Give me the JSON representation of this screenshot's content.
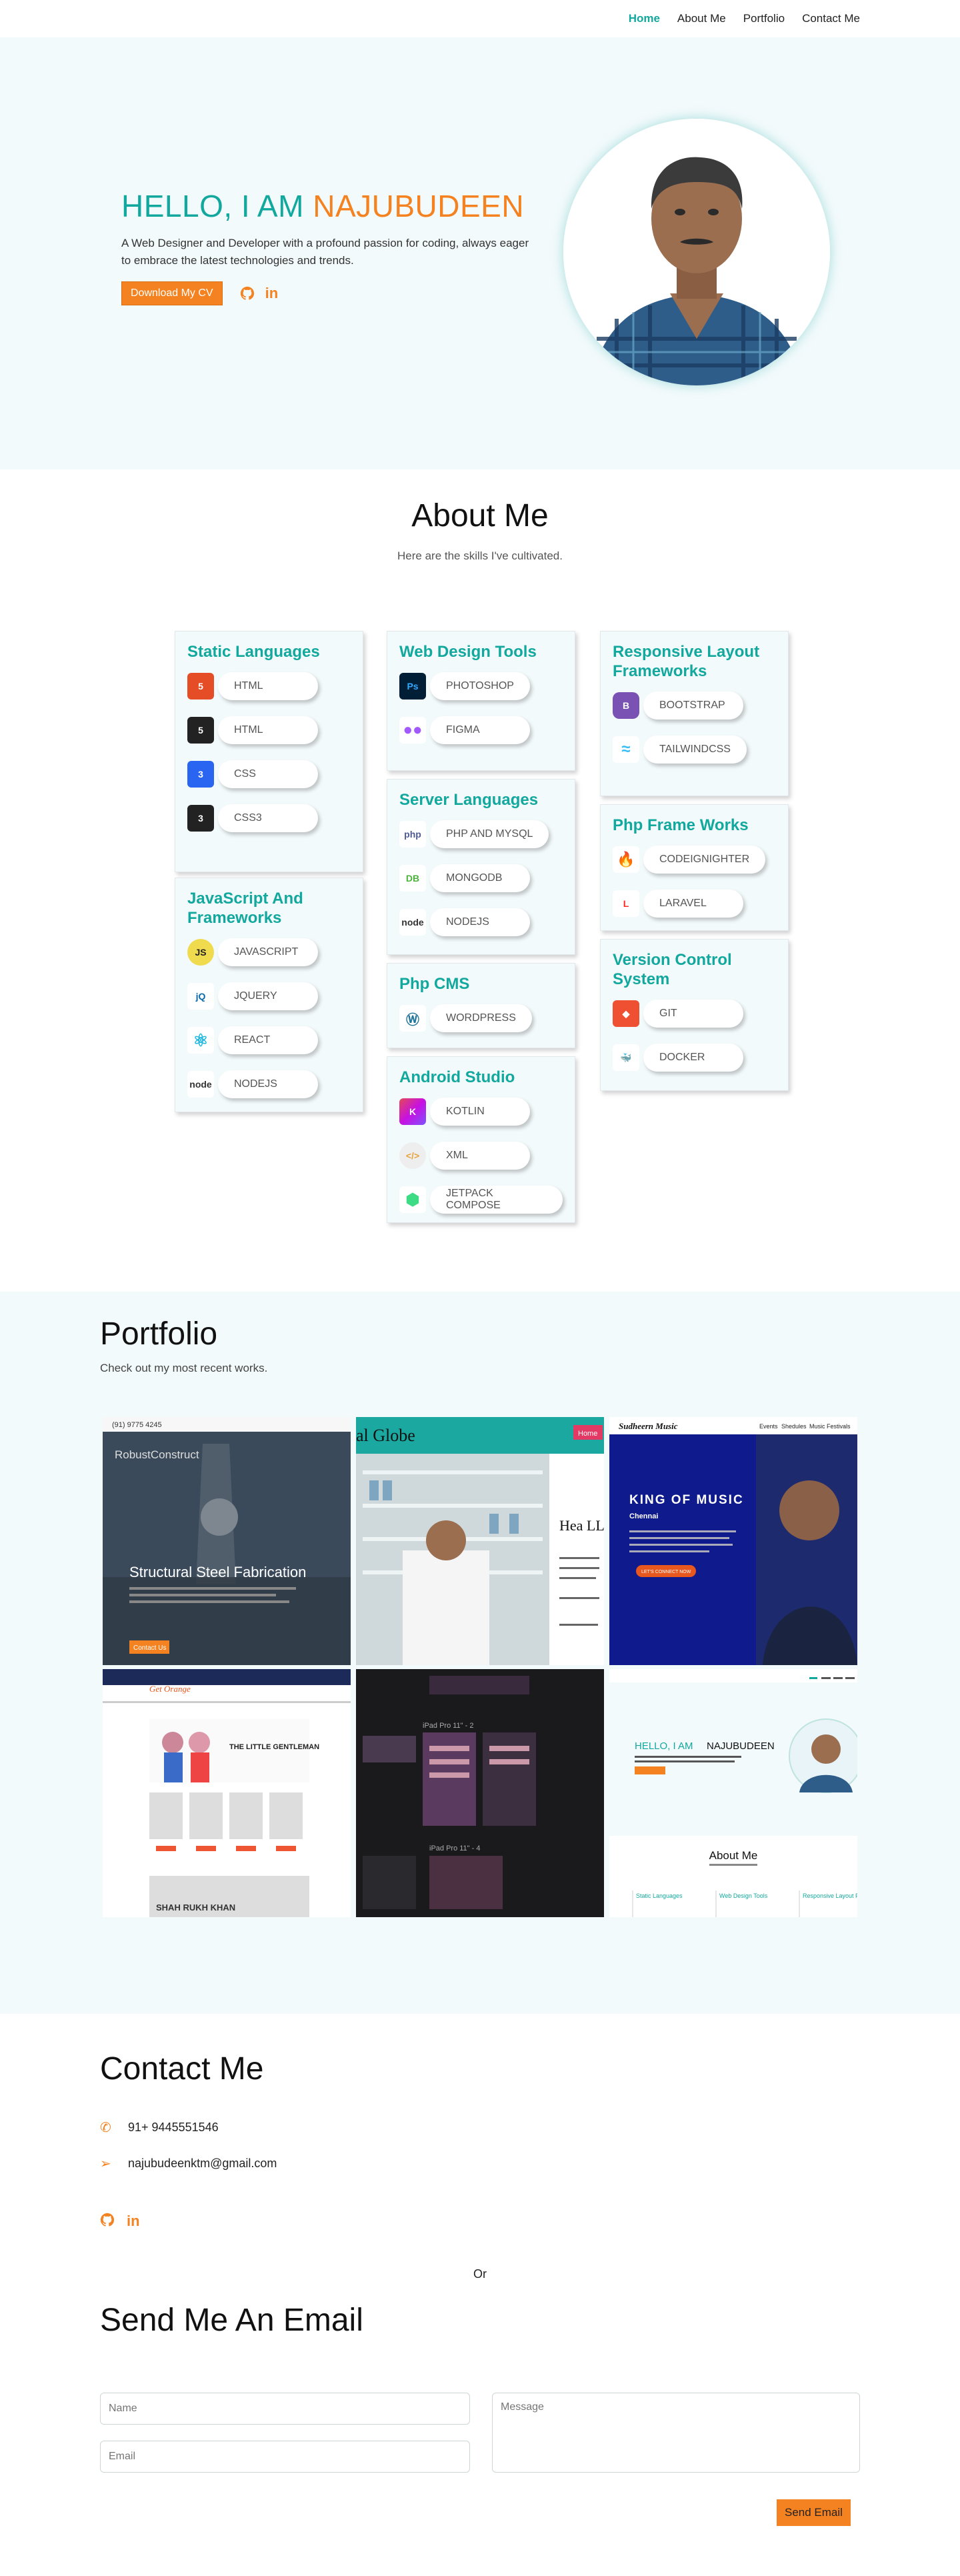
{
  "nav": {
    "items": [
      {
        "label": "Home",
        "active": true
      },
      {
        "label": "About Me"
      },
      {
        "label": "Portfolio"
      },
      {
        "label": "Contact Me"
      }
    ]
  },
  "hero": {
    "greeting": "HELLO, I AM ",
    "name": "NAJUBUDEEN",
    "description": "A Web Designer and Developer with a profound passion for coding, always eager to embrace the latest technologies and trends.",
    "cv_button": "Download My CV",
    "social": [
      "github-icon",
      "linkedin-icon"
    ]
  },
  "about": {
    "title": "About Me",
    "subtitle": "Here are the skills I've cultivated.",
    "cards": [
      {
        "title": "Static Languages",
        "skills": [
          "HTML",
          "HTML",
          "CSS",
          "CSS3"
        ]
      },
      {
        "title": "JavaScript And Frameworks",
        "skills": [
          "JAVASCRIPT",
          "JQUERY",
          "REACT",
          "NODEJS"
        ]
      },
      {
        "title": "Web Design Tools",
        "skills": [
          "PHOTOSHOP",
          "FIGMA"
        ]
      },
      {
        "title": "Server Languages",
        "skills": [
          "PHP AND MYSQL",
          "MONGODB",
          "NODEJS"
        ]
      },
      {
        "title": "Php CMS",
        "skills": [
          "WORDPRESS"
        ]
      },
      {
        "title": "Android Studio",
        "skills": [
          "KOTLIN",
          "XML",
          "JETPACK COMPOSE"
        ]
      },
      {
        "title": "Responsive Layout Frameworks",
        "skills": [
          "BOOTSTRAP",
          "TAILWINDCSS"
        ]
      },
      {
        "title": "Php Frame Works",
        "skills": [
          "CODEIGNIGHTER",
          "LARAVEL"
        ]
      },
      {
        "title": "Version Control System",
        "skills": [
          "GIT",
          "DOCKER"
        ]
      }
    ]
  },
  "portfolio": {
    "title": "Portfolio",
    "subtitle": "Check out my most recent works.",
    "tiles": [
      {
        "brand": "RobustConstruct",
        "heading": "Structural Steel Fabrication",
        "button": "Contact Us",
        "phone": "(91) 9775 4245"
      },
      {
        "brand": "al Globe",
        "heading": "Hea LLP",
        "button": "Home"
      },
      {
        "brand": "Sudheern Music",
        "heading": "KING OF MUSIC",
        "sub": "Chennai",
        "button": "LET'S CONNECT NOW",
        "menu": [
          "Events",
          "Shedules",
          "Music Festivals"
        ]
      },
      {
        "brand": "Get Orange",
        "heading": "THE LITTLE GENTLEMAN",
        "sub": "SHAH RUKH KHAN"
      },
      {
        "labels": [
          "iPad Pro 11\" - 2",
          "iPad Pro 11\" - 4"
        ]
      },
      {
        "greeting": "HELLO, I AM ",
        "name": "NAJUBUDEEN",
        "heading": "About Me",
        "cols": [
          "Static Languages",
          "Web Design Tools",
          "Responsive Layout Frameworks"
        ]
      }
    ]
  },
  "contact": {
    "title": "Contact Me",
    "phone": "91+ 9445551546",
    "email": "najubudeenktm@gmail.com",
    "or": "Or",
    "email_title": "Send Me An Email",
    "name_placeholder": "Name",
    "email_placeholder": "Email",
    "message_placeholder": "Message",
    "send_label": "Send Email"
  },
  "colors": {
    "accent": "#13a89e",
    "brand": "#f58220",
    "bg_light": "#f3fafc"
  }
}
